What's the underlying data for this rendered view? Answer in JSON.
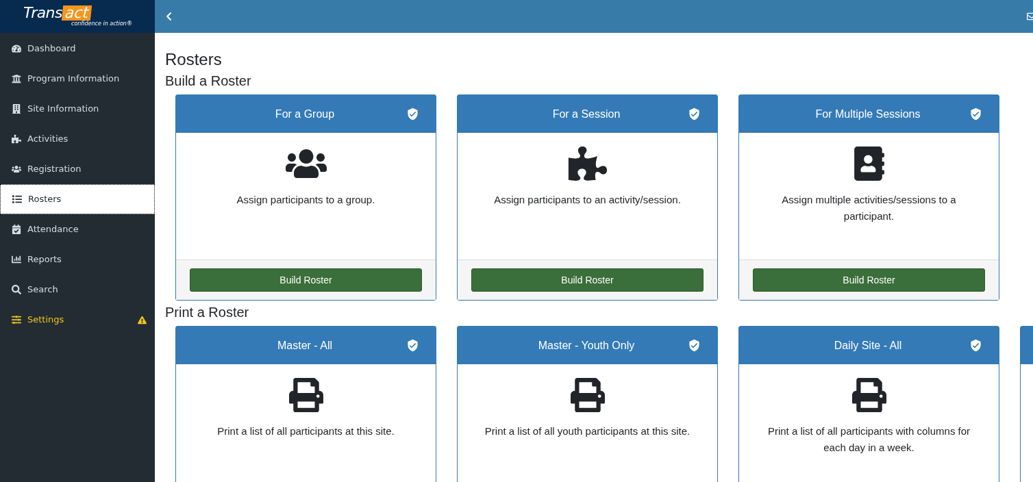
{
  "logo": {
    "part_1": "Trans",
    "part_2": "act",
    "tagline": "confidence in action®"
  },
  "sidebar": {
    "items": [
      {
        "label": "Dashboard",
        "selected": false,
        "warning": false
      },
      {
        "label": "Program Information",
        "selected": false,
        "warning": false
      },
      {
        "label": "Site Information",
        "selected": false,
        "warning": false
      },
      {
        "label": "Activities",
        "selected": false,
        "warning": false
      },
      {
        "label": "Registration",
        "selected": false,
        "warning": false
      },
      {
        "label": "Rosters",
        "selected": true,
        "warning": false
      },
      {
        "label": "Attendance",
        "selected": false,
        "warning": false
      },
      {
        "label": "Reports",
        "selected": false,
        "warning": false
      },
      {
        "label": "Search",
        "selected": false,
        "warning": false
      },
      {
        "label": "Settings",
        "selected": false,
        "warning": true
      }
    ]
  },
  "page": {
    "title": "Rosters"
  },
  "sections": [
    {
      "heading": "Build a Roster",
      "cards": [
        {
          "title": "For a Group",
          "description": "Assign participants to a group.",
          "button": "Build Roster"
        },
        {
          "title": "For a Session",
          "description": "Assign participants to an activity/session.",
          "button": "Build Roster"
        },
        {
          "title": "For Multiple Sessions",
          "description": "Assign multiple activities/sessions to a participant.",
          "button": "Build Roster"
        }
      ]
    },
    {
      "heading": "Print a Roster",
      "cards": [
        {
          "title": "Master - All",
          "description": "Print a list of all participants at this site."
        },
        {
          "title": "Master - Youth Only",
          "description": "Print a list of all youth participants at this site."
        },
        {
          "title": "Daily Site - All",
          "description": "Print a list of all participants with columns for each day in a week."
        },
        {
          "partial": true
        }
      ]
    }
  ]
}
